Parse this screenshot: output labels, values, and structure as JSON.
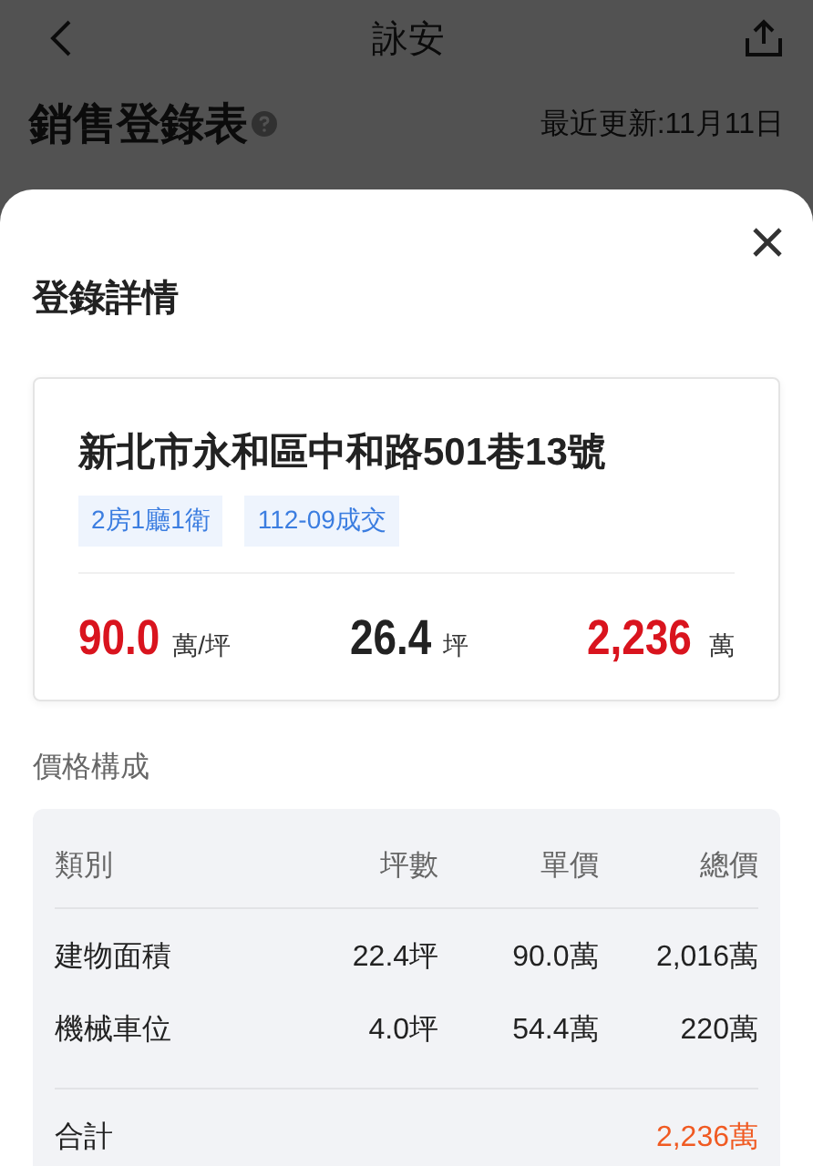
{
  "nav": {
    "title": "詠安"
  },
  "page": {
    "title": "銷售登錄表",
    "updated": "最近更新:11月11日"
  },
  "sheet": {
    "title": "登錄詳情",
    "address": "新北市永和區中和路501巷13號",
    "tags": [
      "2房1廳1衛",
      "112-09成交"
    ],
    "stats": [
      {
        "value": "90.0",
        "unit": "萬/坪",
        "highlight": true
      },
      {
        "value": "26.4",
        "unit": "坪",
        "highlight": false
      },
      {
        "value": "2,236",
        "unit": "萬",
        "highlight": true
      }
    ],
    "section": "價格構成",
    "table": {
      "columns": [
        "類別",
        "坪數",
        "單價",
        "總價"
      ],
      "rows": [
        [
          "建物面積",
          "22.4坪",
          "90.0萬",
          "2,016萬"
        ],
        [
          "機械車位",
          "4.0坪",
          "54.4萬",
          "220萬"
        ]
      ],
      "total": {
        "label": "合計",
        "value": "2,236萬"
      }
    }
  }
}
